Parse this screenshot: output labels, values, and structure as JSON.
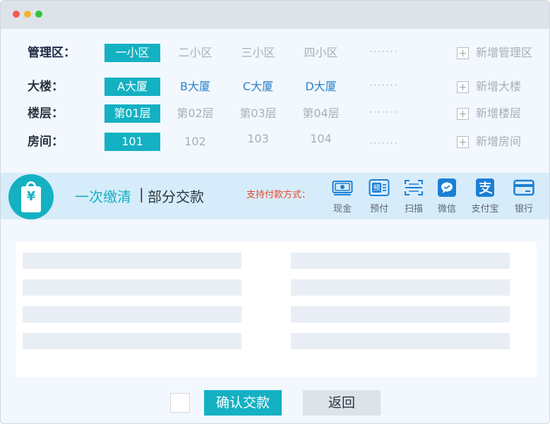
{
  "rows": [
    {
      "label": "管理区：",
      "options": [
        "一小区",
        "二小区",
        "三小区",
        "四小区"
      ],
      "more": "·······",
      "add": "新增管理区"
    },
    {
      "label": "大楼：",
      "options": [
        "A大厦",
        "B大厦",
        "C大厦",
        "D大厦"
      ],
      "more": "·······",
      "add": "新增大楼"
    },
    {
      "label": "楼层：",
      "options": [
        "第01层",
        "第02层",
        "第03层",
        "第04层"
      ],
      "more": "·······",
      "add": "新增楼层"
    },
    {
      "label": "房间：",
      "options": [
        "101",
        "102",
        "103",
        "104"
      ],
      "more": "·······",
      "add": "新增房间"
    }
  ],
  "payment": {
    "bag_symbol": "¥",
    "mode_full": "一次缴清",
    "separator": "|",
    "mode_partial": "部分交款",
    "support_label": "支持付款方式：",
    "methods": [
      "现金",
      "预付",
      "扫描",
      "微信",
      "支付宝",
      "银行"
    ],
    "prepaid_icon_text": "预"
  },
  "actions": {
    "confirm": "确认交款",
    "back": "返回"
  },
  "colors": {
    "accent": "#14b1c3",
    "link_blue": "#2d82c9",
    "icon_blue": "#1b7fd6",
    "warning_red": "#e7472c"
  }
}
